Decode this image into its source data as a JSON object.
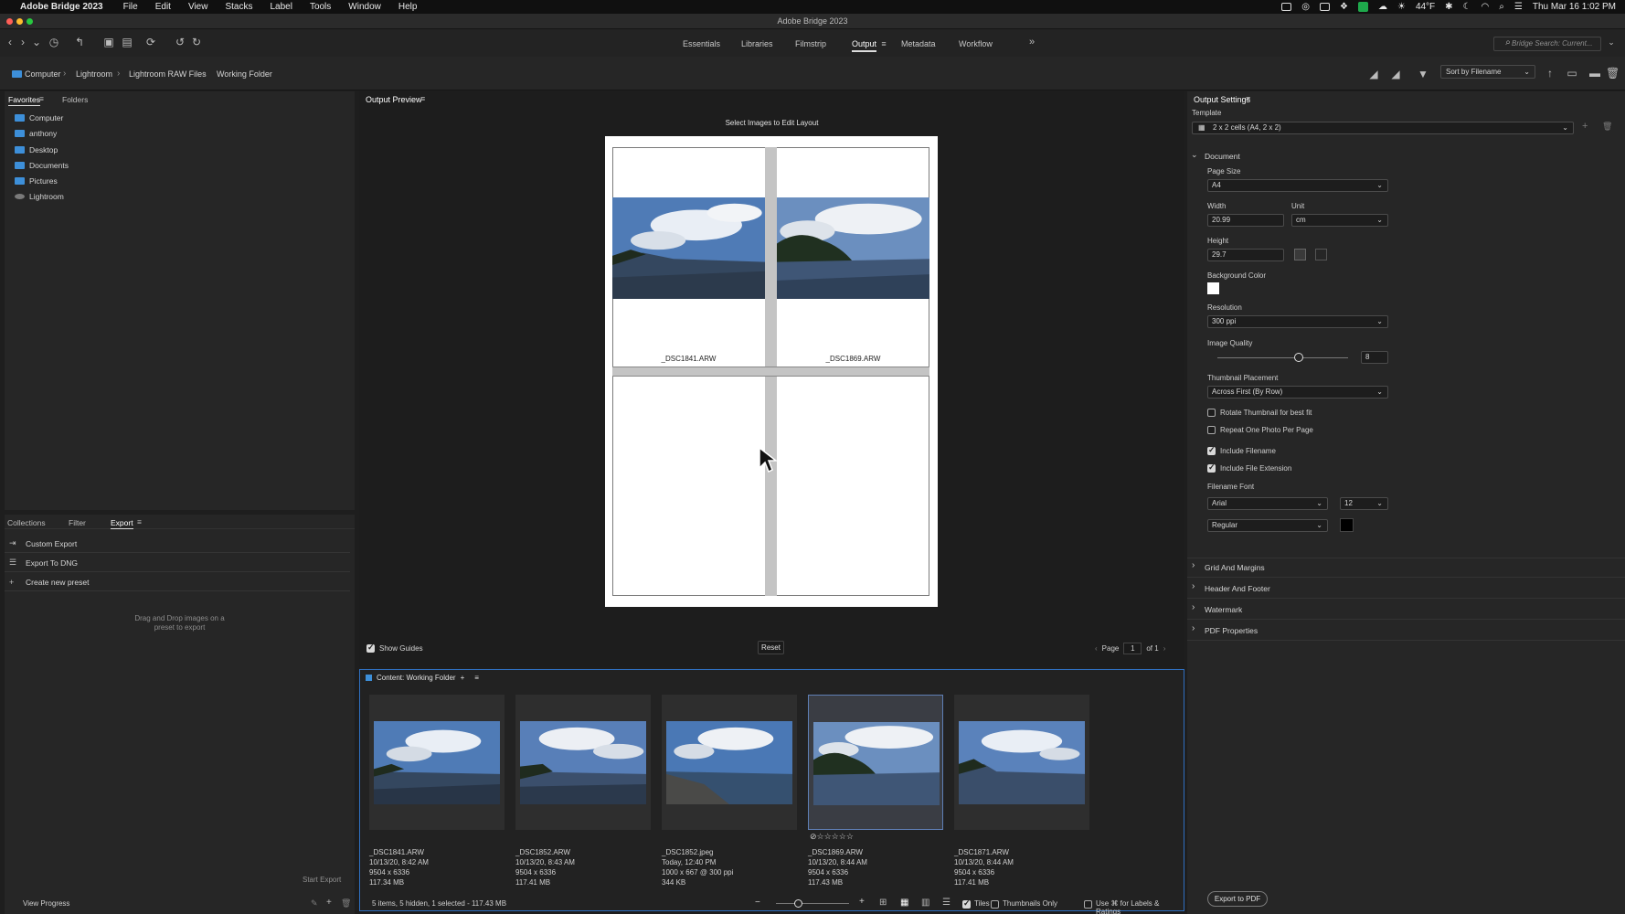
{
  "menubar": {
    "app_name": "Adobe Bridge 2023",
    "items": [
      "File",
      "Edit",
      "View",
      "Stacks",
      "Label",
      "Tools",
      "Window",
      "Help"
    ],
    "weather": "44°F",
    "clock": "Thu Mar 16  1:02 PM"
  },
  "window_title": "Adobe Bridge 2023",
  "workspaces": [
    "Essentials",
    "Libraries",
    "Filmstrip",
    "Output",
    "Metadata",
    "Workflow"
  ],
  "active_workspace": "Output",
  "search_placeholder": "Bridge Search: Current...",
  "breadcrumb": [
    "Computer",
    "Lightroom",
    "Lightroom RAW Files",
    "Working Folder"
  ],
  "sort_label": "Sort by Filename",
  "left_panel": {
    "tabs": [
      "Favorites",
      "Folders"
    ],
    "favorites": [
      "Computer",
      "anthony",
      "Desktop",
      "Documents",
      "Pictures",
      "Lightroom"
    ],
    "bottom_tabs": [
      "Collections",
      "Filter",
      "Export"
    ],
    "export_items": [
      "Custom Export",
      "Export To DNG",
      "Create new preset"
    ],
    "drop_hint_1": "Drag and Drop images on a",
    "drop_hint_2": "preset to export",
    "start_export": "Start Export",
    "view_progress": "View Progress"
  },
  "preview": {
    "title": "Output Preview",
    "instruction": "Select Images to Edit Layout",
    "cells": [
      "_DSC1841.ARW",
      "_DSC1869.ARW"
    ],
    "show_guides": "Show Guides",
    "reset": "Reset",
    "page_label": "Page",
    "page_value": "1",
    "page_of": "of 1"
  },
  "content": {
    "title": "Content: Working Folder",
    "items": [
      {
        "name": "_DSC1841.ARW",
        "date": "10/13/20, 8:42 AM",
        "dims": "9504 x 6336",
        "size": "117.34 MB"
      },
      {
        "name": "_DSC1852.ARW",
        "date": "10/13/20, 8:43 AM",
        "dims": "9504 x 6336",
        "size": "117.41 MB"
      },
      {
        "name": "_DSC1852.jpeg",
        "date": "Today, 12:40 PM",
        "dims": "1000 x 667 @ 300 ppi",
        "size": "344 KB"
      },
      {
        "name": "_DSC1869.ARW",
        "date": "10/13/20, 8:44 AM",
        "dims": "9504 x 6336",
        "size": "117.43 MB"
      },
      {
        "name": "_DSC1871.ARW",
        "date": "10/13/20, 8:44 AM",
        "dims": "9504 x 6336",
        "size": "117.41 MB"
      }
    ],
    "status": "5 items, 5 hidden, 1 selected - 117.43 MB",
    "tiles": "Tiles",
    "thumbnails_only": "Thumbnails Only",
    "use_cmd": "Use ⌘ for Labels & Ratings"
  },
  "settings": {
    "title": "Output Settings",
    "template_label": "Template",
    "template_value": "2 x 2 cells (A4, 2 x 2)",
    "document": "Document",
    "page_size_label": "Page Size",
    "page_size": "A4",
    "width_label": "Width",
    "width": "20.99",
    "unit_label": "Unit",
    "unit": "cm",
    "height_label": "Height",
    "height": "29.7",
    "bg_label": "Background Color",
    "resolution_label": "Resolution",
    "resolution": "300 ppi",
    "quality_label": "Image Quality",
    "quality": "8",
    "placement_label": "Thumbnail Placement",
    "placement": "Across First (By Row)",
    "rotate": "Rotate Thumbnail for best fit",
    "repeat": "Repeat One Photo Per Page",
    "include_filename": "Include Filename",
    "include_ext": "Include File Extension",
    "font_label": "Filename Font",
    "font": "Arial",
    "font_size": "12",
    "font_style": "Regular",
    "sections": [
      "Grid And Margins",
      "Header And Footer",
      "Watermark",
      "PDF Properties"
    ],
    "export_pdf": "Export to PDF"
  },
  "colors": {
    "accent": "#2f6fc0",
    "folder": "#3d8fd9"
  }
}
